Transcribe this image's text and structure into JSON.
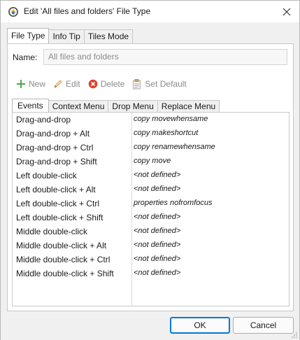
{
  "window": {
    "title": "Edit 'All files and folders' File Type"
  },
  "outer_tabs": [
    {
      "label": "File Type",
      "active": true
    },
    {
      "label": "Info Tip",
      "active": false
    },
    {
      "label": "Tiles Mode",
      "active": false
    }
  ],
  "name": {
    "label": "Name:",
    "value": "All files and folders"
  },
  "toolbar": {
    "new_label": "New",
    "edit_label": "Edit",
    "delete_label": "Delete",
    "set_default_label": "Set Default"
  },
  "inner_tabs": [
    {
      "label": "Events",
      "active": true
    },
    {
      "label": "Context Menu",
      "active": false
    },
    {
      "label": "Drop Menu",
      "active": false
    },
    {
      "label": "Replace Menu",
      "active": false
    }
  ],
  "events": [
    {
      "event": "Drag-and-drop",
      "command": "copy movewhensame"
    },
    {
      "event": "Drag-and-drop + Alt",
      "command": "copy makeshortcut"
    },
    {
      "event": "Drag-and-drop + Ctrl",
      "command": "copy renamewhensame"
    },
    {
      "event": "Drag-and-drop + Shift",
      "command": "copy move"
    },
    {
      "event": "Left double-click",
      "command": "<not defined>"
    },
    {
      "event": "Left double-click + Alt",
      "command": "<not defined>"
    },
    {
      "event": "Left double-click + Ctrl",
      "command": "properties nofromfocus"
    },
    {
      "event": "Left double-click + Shift",
      "command": "<not defined>"
    },
    {
      "event": "Middle double-click",
      "command": "<not defined>"
    },
    {
      "event": "Middle double-click + Alt",
      "command": "<not defined>"
    },
    {
      "event": "Middle double-click + Ctrl",
      "command": "<not defined>"
    },
    {
      "event": "Middle double-click + Shift",
      "command": "<not defined>"
    }
  ],
  "buttons": {
    "ok_label": "OK",
    "cancel_label": "Cancel"
  },
  "colors": {
    "accent": "#0078d4",
    "new_icon": "#4caf50",
    "delete_icon": "#e0412d"
  },
  "icons": [
    "app-icon",
    "close-icon",
    "plus-icon",
    "pencil-icon",
    "delete-icon",
    "set-default-icon",
    "resize-grip-icon"
  ]
}
